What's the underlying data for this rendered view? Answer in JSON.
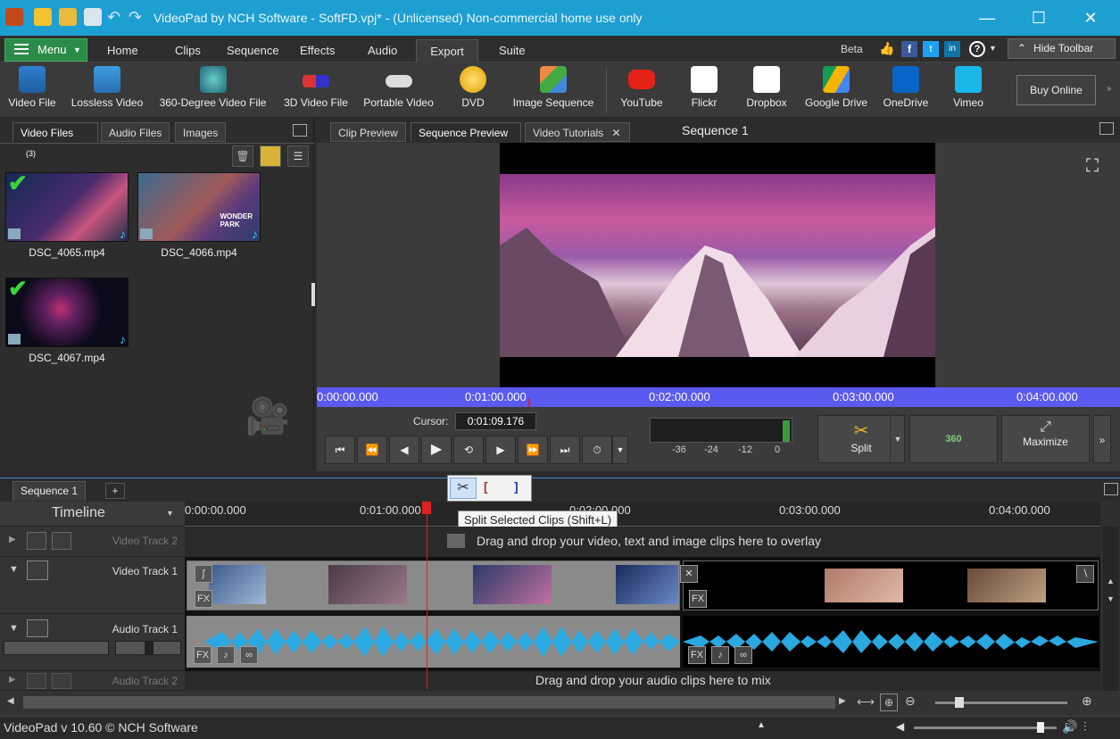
{
  "window": {
    "title": "VideoPad by NCH Software - SoftFD.vpj* - (Unlicensed) Non-commercial home use only",
    "controls": {
      "minimize": "—",
      "maximize": "☐",
      "close": "✕"
    }
  },
  "menu": {
    "menu_label": "Menu",
    "tabs": [
      "Home",
      "Clips",
      "Sequence",
      "Effects",
      "Audio",
      "Export",
      "Suite"
    ],
    "active_tab": "Export",
    "beta": "Beta",
    "hide_toolbar": "Hide Toolbar"
  },
  "toolbar": {
    "items": [
      {
        "label": "Video File",
        "icon": "video-file-icon"
      },
      {
        "label": "Lossless Video",
        "icon": "lossless-video-icon"
      },
      {
        "label": "360-Degree Video File",
        "icon": "360-video-icon"
      },
      {
        "label": "3D Video File",
        "icon": "3d-glasses-icon"
      },
      {
        "label": "Portable Video",
        "icon": "portable-video-icon"
      },
      {
        "label": "DVD",
        "icon": "dvd-icon"
      },
      {
        "label": "Image Sequence",
        "icon": "image-sequence-icon"
      },
      {
        "label": "YouTube",
        "icon": "youtube-icon"
      },
      {
        "label": "Flickr",
        "icon": "flickr-icon"
      },
      {
        "label": "Dropbox",
        "icon": "dropbox-icon"
      },
      {
        "label": "Google Drive",
        "icon": "google-drive-icon"
      },
      {
        "label": "OneDrive",
        "icon": "onedrive-icon"
      },
      {
        "label": "Vimeo",
        "icon": "vimeo-icon"
      }
    ],
    "buy_online": "Buy Online"
  },
  "media_bin": {
    "tabs": {
      "video": "Video Files",
      "video_count": "(3)",
      "audio": "Audio Files",
      "images": "Images"
    },
    "files": [
      {
        "name": "DSC_4065.mp4"
      },
      {
        "name": "DSC_4066.mp4"
      },
      {
        "name": "DSC_4067.mp4"
      }
    ]
  },
  "preview": {
    "tabs": {
      "clip": "Clip Preview",
      "sequence": "Sequence Preview",
      "tutorials": "Video Tutorials"
    },
    "sequence_title": "Sequence 1",
    "ruler": [
      "0:00:00.000",
      "0:01:00.000",
      "0:02:00.000",
      "0:03:00.000",
      "0:04:00.000"
    ],
    "cursor_label": "Cursor:",
    "cursor_value": "0:01:09.176",
    "meter": [
      "-36",
      "-24",
      "-12",
      "0"
    ],
    "split": "Split",
    "btn360": "360",
    "maximize": "Maximize"
  },
  "timeline": {
    "seq_tab": "Sequence 1",
    "add_tab": "+",
    "title": "Timeline",
    "ruler": [
      "0:00:00.000",
      "0:01:00.000",
      "0:02:00.000",
      "0:03:00.000",
      "0:04:00.000"
    ],
    "tooltip": "Split Selected Clips (Shift+L)",
    "tracks": {
      "video2": "Video Track 2",
      "video2_hint": "Drag and drop your video, text and image clips here to overlay",
      "video1": "Video Track 1",
      "audio1": "Audio Track 1",
      "audio2": "Audio Track 2",
      "audio2_hint": "Drag and drop your audio clips here to mix"
    },
    "fx": "FX"
  },
  "status": {
    "version": "VideoPad v 10.60 © NCH Software"
  },
  "colors": {
    "titlebar": "#1e9fd1",
    "accent_green": "#2a8c48",
    "ruler_blue": "#5a5af0",
    "playhead": "#e02020",
    "waveform": "#2aa8e0"
  }
}
